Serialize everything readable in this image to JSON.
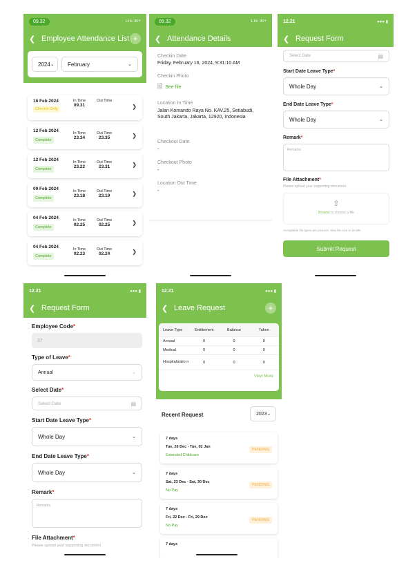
{
  "colors": {
    "brand": "#7dc24f",
    "brand_dark": "#4ba82a",
    "pending": "#f3a63b",
    "required": "#e53935"
  },
  "screen1": {
    "time": "09.32",
    "status": "LTE 30+",
    "title": "Employee Attendance List",
    "year": "2024",
    "month": "February",
    "in_label": "In Time",
    "out_label": "Out Time",
    "rows": [
      {
        "date": "16 Feb 2024",
        "status": "Checkin Only",
        "in": "09.31",
        "out": "",
        "kind": "ci"
      },
      {
        "date": "12 Feb 2024",
        "status": "Complete",
        "in": "23.34",
        "out": "23.35",
        "kind": "ok"
      },
      {
        "date": "12 Feb 2024",
        "status": "Complete",
        "in": "23.22",
        "out": "23.31",
        "kind": "ok"
      },
      {
        "date": "09 Feb 2024",
        "status": "Complete",
        "in": "23.18",
        "out": "23.19",
        "kind": "ok"
      },
      {
        "date": "04 Feb 2024",
        "status": "Complete",
        "in": "02.25",
        "out": "02.25",
        "kind": "ok"
      },
      {
        "date": "04 Feb 2024",
        "status": "Complete",
        "in": "02.23",
        "out": "02.24",
        "kind": "ok"
      }
    ]
  },
  "screen2": {
    "time": "09.32",
    "status": "LTE 30+",
    "title": "Attendance Details",
    "checkin_date_label": "Checkin Date",
    "checkin_date": "Friday, February 16, 2024, 9:31:10 AM",
    "checkin_photo_label": "Checkin Photo",
    "see_file": "See file",
    "loc_in_label": "Location In Time",
    "loc_in": "Jalan Komando Raya No. KAV.25, Setiabudi, South Jakarta, Jakarta, 12920, Indonesia",
    "checkout_date_label": "Checkout Date",
    "checkout_date": "-",
    "checkout_photo_label": "Checkout Photo",
    "checkout_photo": "-",
    "loc_out_label": "Location Out Time",
    "loc_out": "-"
  },
  "screen3": {
    "time": "12.21",
    "title": "Request Form",
    "select_date_placeholder": "Select Date",
    "start_type_label": "Start Date Leave Type",
    "start_type": "Whole Day",
    "end_type_label": "End Date Leave Type",
    "end_type": "Whole Day",
    "remark_label": "Remark",
    "remark_placeholder": "Remarks",
    "file_label": "File Attachment",
    "file_hint": "Please upload your supporting document",
    "browse": "Browse",
    "browse_rest": " to choose a file",
    "types_hint": "Acceptable file types are pictures. Max file size is 15 MB",
    "submit": "Submit Request"
  },
  "screen4": {
    "time": "12.21",
    "title": "Request Form",
    "emp_code_label": "Employee Code",
    "emp_code": "37",
    "type_label": "Type of Leave",
    "type": "Annual",
    "select_date_label": "Select Date",
    "select_date_placeholder": "Select Date",
    "start_type_label": "Start Date Leave Type",
    "start_type": "Whole Day",
    "end_type_label": "End Date Leave Type",
    "end_type": "Whole Day",
    "remark_label": "Remark",
    "remark_placeholder": "Remarks",
    "file_label": "File Attachment",
    "file_hint": "Please upload your supporting document"
  },
  "screen5": {
    "time": "12.21",
    "title": "Leave Request",
    "headers": [
      "Leave Type",
      "Entitlement",
      "Balance",
      "Taken"
    ],
    "rows": [
      [
        "Annual",
        "0",
        "0",
        "0"
      ],
      [
        "Medical",
        "0",
        "0",
        "0"
      ],
      [
        "Hospitalizatio n",
        "0",
        "0",
        "0"
      ]
    ],
    "view_more": "View More",
    "recent_label": "Recent Request",
    "year": "2023",
    "requests": [
      {
        "days": "7 days",
        "range": "Tue, 26 Dec - Tue, 02 Jan",
        "type": "Extended Childcare",
        "status": "PENDING"
      },
      {
        "days": "7 days",
        "range": "Sat, 23 Dec - Sat, 30 Dec",
        "type": "No Pay",
        "status": "PENDING"
      },
      {
        "days": "7 days",
        "range": "Fri, 22 Dec - Fri, 29 Dec",
        "type": "No Pay",
        "status": "PENDING"
      },
      {
        "days": "7 days",
        "range": "",
        "type": "",
        "status": ""
      }
    ]
  }
}
